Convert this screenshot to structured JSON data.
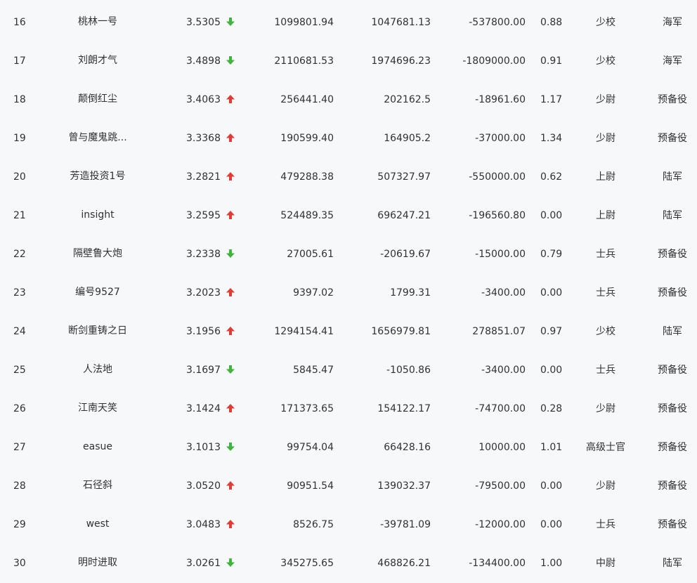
{
  "colors": {
    "up": "#e23b36",
    "down": "#3fb33a",
    "background": "#f7f8fa",
    "text": "#303133"
  },
  "rows": [
    {
      "rank": "16",
      "name": "桃林一号",
      "score": "3.5305",
      "trend": "down",
      "v1": "1099801.94",
      "v2": "1047681.13",
      "v3": "-537800.00",
      "ratio": "0.88",
      "grade": "少校",
      "branch": "海军"
    },
    {
      "rank": "17",
      "name": "刘朗才气",
      "score": "3.4898",
      "trend": "down",
      "v1": "2110681.53",
      "v2": "1974696.23",
      "v3": "-1809000.00",
      "ratio": "0.91",
      "grade": "少校",
      "branch": "海军"
    },
    {
      "rank": "18",
      "name": "颠倒红尘",
      "score": "3.4063",
      "trend": "up",
      "v1": "256441.40",
      "v2": "202162.5",
      "v3": "-18961.60",
      "ratio": "1.17",
      "grade": "少尉",
      "branch": "预备役"
    },
    {
      "rank": "19",
      "name": "曾与魔鬼跳...",
      "score": "3.3368",
      "trend": "up",
      "v1": "190599.40",
      "v2": "164905.2",
      "v3": "-37000.00",
      "ratio": "1.34",
      "grade": "少尉",
      "branch": "预备役"
    },
    {
      "rank": "20",
      "name": "芳造投资1号",
      "score": "3.2821",
      "trend": "up",
      "v1": "479288.38",
      "v2": "507327.97",
      "v3": "-550000.00",
      "ratio": "0.62",
      "grade": "上尉",
      "branch": "陆军"
    },
    {
      "rank": "21",
      "name": "insight",
      "score": "3.2595",
      "trend": "up",
      "v1": "524489.35",
      "v2": "696247.21",
      "v3": "-196560.80",
      "ratio": "0.00",
      "grade": "上尉",
      "branch": "陆军"
    },
    {
      "rank": "22",
      "name": "隔壁鲁大炮",
      "score": "3.2338",
      "trend": "down",
      "v1": "27005.61",
      "v2": "-20619.67",
      "v3": "-15000.00",
      "ratio": "0.79",
      "grade": "士兵",
      "branch": "预备役"
    },
    {
      "rank": "23",
      "name": "编号9527",
      "score": "3.2023",
      "trend": "up",
      "v1": "9397.02",
      "v2": "1799.31",
      "v3": "-3400.00",
      "ratio": "0.00",
      "grade": "士兵",
      "branch": "预备役"
    },
    {
      "rank": "24",
      "name": "断剑重铸之日",
      "score": "3.1956",
      "trend": "up",
      "v1": "1294154.41",
      "v2": "1656979.81",
      "v3": "278851.07",
      "ratio": "0.97",
      "grade": "少校",
      "branch": "陆军"
    },
    {
      "rank": "25",
      "name": "人法地",
      "score": "3.1697",
      "trend": "down",
      "v1": "5845.47",
      "v2": "-1050.86",
      "v3": "-3400.00",
      "ratio": "0.00",
      "grade": "士兵",
      "branch": "预备役"
    },
    {
      "rank": "26",
      "name": "江南天笑",
      "score": "3.1424",
      "trend": "up",
      "v1": "171373.65",
      "v2": "154122.17",
      "v3": "-74700.00",
      "ratio": "0.28",
      "grade": "少尉",
      "branch": "预备役"
    },
    {
      "rank": "27",
      "name": "easue",
      "score": "3.1013",
      "trend": "down",
      "v1": "99754.04",
      "v2": "66428.16",
      "v3": "10000.00",
      "ratio": "1.01",
      "grade": "高级士官",
      "branch": "预备役"
    },
    {
      "rank": "28",
      "name": "石径斜",
      "score": "3.0520",
      "trend": "up",
      "v1": "90951.54",
      "v2": "139032.37",
      "v3": "-79500.00",
      "ratio": "0.00",
      "grade": "少尉",
      "branch": "预备役"
    },
    {
      "rank": "29",
      "name": "west",
      "score": "3.0483",
      "trend": "up",
      "v1": "8526.75",
      "v2": "-39781.09",
      "v3": "-12000.00",
      "ratio": "0.00",
      "grade": "士兵",
      "branch": "预备役"
    },
    {
      "rank": "30",
      "name": "明时进取",
      "score": "3.0261",
      "trend": "down",
      "v1": "345275.65",
      "v2": "468826.21",
      "v3": "-134400.00",
      "ratio": "1.00",
      "grade": "中尉",
      "branch": "陆军"
    }
  ]
}
